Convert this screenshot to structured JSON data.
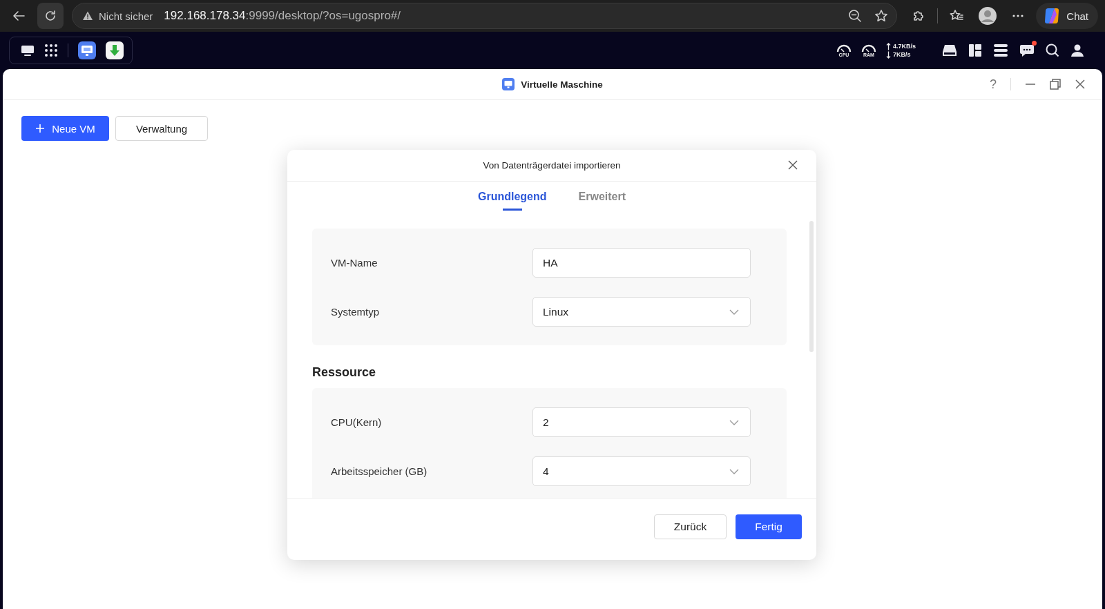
{
  "browser": {
    "security_label": "Nicht sicher",
    "url_host": "192.168.178.34",
    "url_rest": ":9999/desktop/?os=ugospro#/",
    "chat_label": "Chat"
  },
  "taskbar": {
    "apps": [
      {
        "kind": "vm"
      },
      {
        "kind": "download"
      }
    ],
    "cpu_label": "CPU",
    "ram_label": "RAM",
    "net_up": "4.7KB/s",
    "net_down": "7KB/s",
    "notification": true
  },
  "window": {
    "title": "Virtuelle Maschine",
    "help_label": "?"
  },
  "toolbar": [
    {
      "label": "Neue VM",
      "kind": "primary"
    },
    {
      "label": "Verwaltung",
      "kind": "default"
    }
  ],
  "dialog": {
    "title": "Von Datenträgerdatei importieren",
    "tabs": [
      {
        "label": "Grundlegend",
        "selected": true
      },
      {
        "label": "Erweitert",
        "selected": false
      }
    ],
    "sections": [
      {
        "fields": [
          {
            "label": "VM-Name",
            "kind": "text",
            "value": "HA"
          },
          {
            "label": "Systemtyp",
            "kind": "select",
            "value": "Linux"
          }
        ]
      },
      {
        "heading": "Ressource",
        "fields": [
          {
            "label": "CPU(Kern)",
            "kind": "select",
            "value": "2"
          },
          {
            "label": "Arbeitsspeicher (GB)",
            "kind": "select",
            "value": "4"
          }
        ]
      }
    ],
    "buttons": [
      {
        "label": "Zurück",
        "kind": "default"
      },
      {
        "label": "Fertig",
        "kind": "primary"
      }
    ]
  }
}
